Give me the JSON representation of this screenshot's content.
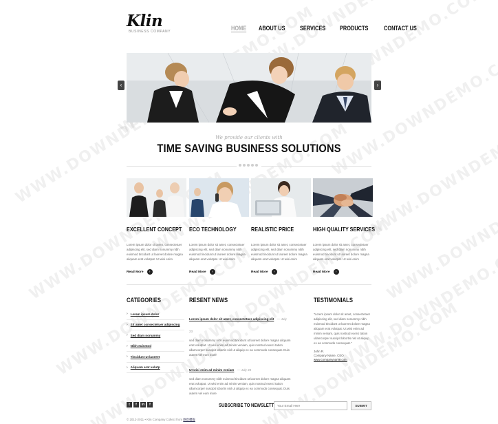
{
  "logo": {
    "title": "Klin",
    "subtitle": "BUSINESS COMPANY"
  },
  "nav": {
    "items": [
      {
        "label": "HOME",
        "active": true
      },
      {
        "label": "ABOUT US",
        "active": false
      },
      {
        "label": "SERVICES",
        "active": false
      },
      {
        "label": "PRODUCTS",
        "active": false
      },
      {
        "label": "CONTACT US",
        "active": false
      }
    ]
  },
  "slider": {
    "prev_icon": "‹",
    "next_icon": "›"
  },
  "tagline": {
    "small": "We provide our clients with",
    "main": "TIME SAVING BUSINESS SOLUTIONS"
  },
  "features": [
    {
      "title": "EXCELLENT CONCEPT",
      "text": "Lorem ipsum dolor sit amet, consectetuer adipiscing elit, sed diam nonummy nibh euismod tincidunt ut laoreet dolore magna aliquam erat volutpat. Ut wisi enim",
      "readmore": "Read More"
    },
    {
      "title": "ECO TECHNOLOGY",
      "text": "Lorem ipsum dolor sit amet, consectetuer adipiscing elit, sed diam nonummy nibh euismod tincidunt ut laoreet dolore magna aliquam erat volutpat. Ut wisi enim",
      "readmore": "Read More"
    },
    {
      "title": "REALISTIC PRICE",
      "text": "Lorem ipsum dolor sit amet, consectetuer adipiscing elit, sed diam nonummy nibh euismod tincidunt ut laoreet dolore magna aliquam erat volutpat. Ut wisi enim",
      "readmore": "Read More"
    },
    {
      "title": "HIGH QUALITY SERVICES",
      "text": "Lorem ipsum dolor sit amet, consectetuer adipiscing elit, sed diam nonummy nibh euismod tincidunt ut laoreet dolore magna aliquam erat volutpat. Ut wisi enim",
      "readmore": "Read More"
    }
  ],
  "categories": {
    "title": "CATEGORIES",
    "items": [
      "Lorem ipsum dolor",
      "Sit amet consectetuer adipiscing",
      "Sed diam nonummy",
      "Nibh euismod",
      "Tincidunt ut laoreet",
      "Aliquam erat volutp"
    ]
  },
  "news": {
    "title": "RESENT NEWS",
    "items": [
      {
        "headline": "Lorem ipsum dolor sit amet, consectetuer adipiscing elit",
        "date": "— July 23",
        "body": "sed diam nonummy nibh euismod tincidunt ut laoreet dolore magna aliquam erat volutpat. Ut wisi enim ad minim veniam, quis nostrud exerci tation ullamcorper suscipit lobortis nisl ut aliquip ex ea commodo consequat. Duis autem vel eum iriure"
      },
      {
        "headline": "Ut wisi enim ad minim veniam",
        "date": "— July 20",
        "body": "sed diam nonummy nibh euismod tincidunt ut laoreet dolore magna aliquam erat volutpat. Ut wisi enim ad minim veniam, quis nostrud exerci tation ullamcorper suscipit lobortis nisl ut aliquip ex ea commodo consequat. Duis autem vel eum iriure"
      }
    ]
  },
  "testimonials": {
    "title": "TESTIMONIALS",
    "quote": "\"Lorem ipsum dolor sit amet, consectetuer adipiscing elit, sed diam nonummy nibh euismod tincidunt ut laoreet dolore magna aliquam erat volutpat. Ut wisi enim ad minim veniam, quis nostrud exerci tation ullamcorper suscipit lobortis nisl ut aliquip ex ea commodo consequat.\"",
    "name": "John R.",
    "role": "Company Name, CEO",
    "link": "www.companyname.com"
  },
  "footer": {
    "social": [
      "t",
      "f",
      "in",
      "f"
    ],
    "social_icons": [
      "twitter-icon",
      "facebook-icon",
      "linkedin-icon",
      "flickr-icon"
    ],
    "subscribe_label": "SUBSCRIBE TO NEWSLETTER:",
    "email_placeholder": "Your Email Here",
    "submit_label": "SUBMIT",
    "copyright": "© 2012-2011 • Klin Company Collect from",
    "copyright_link": "网页模板"
  },
  "watermark_text": "WWW.DOWNDEMO.COM"
}
